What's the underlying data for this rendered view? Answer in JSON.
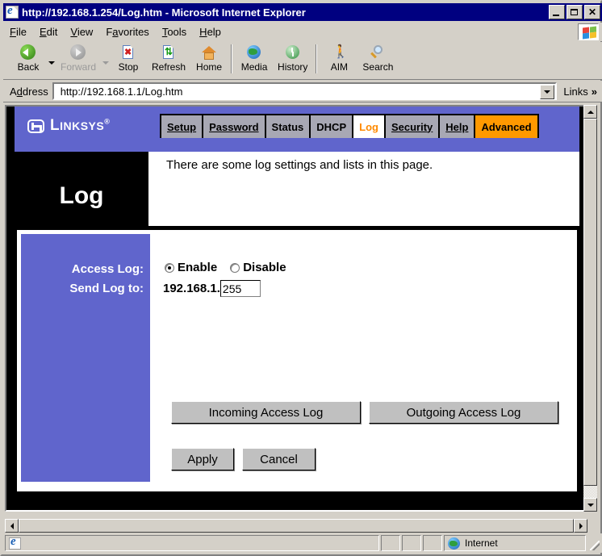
{
  "window": {
    "title": "http://192.168.1.254/Log.htm - Microsoft Internet Explorer",
    "icon": "ie-document-icon",
    "minimize_label": "Minimize",
    "maximize_label": "Maximize",
    "close_label": "Close"
  },
  "menu": {
    "items": [
      {
        "label": "File",
        "accel": "F"
      },
      {
        "label": "Edit",
        "accel": "E"
      },
      {
        "label": "View",
        "accel": "V"
      },
      {
        "label": "Favorites",
        "accel": "a"
      },
      {
        "label": "Tools",
        "accel": "T"
      },
      {
        "label": "Help",
        "accel": "H"
      }
    ],
    "brand_logo": "windows-flag-icon"
  },
  "toolbar": {
    "buttons": [
      {
        "label": "Back",
        "icon": "back-arrow-icon",
        "disabled": false,
        "has_dropdown": true
      },
      {
        "label": "Forward",
        "icon": "forward-arrow-icon",
        "disabled": true,
        "has_dropdown": true
      },
      {
        "label": "Stop",
        "icon": "stop-icon",
        "disabled": false
      },
      {
        "label": "Refresh",
        "icon": "refresh-icon",
        "disabled": false
      },
      {
        "label": "Home",
        "icon": "home-icon",
        "disabled": false
      },
      {
        "label": "Media",
        "icon": "media-globe-icon",
        "disabled": false
      },
      {
        "label": "History",
        "icon": "history-icon",
        "disabled": false
      },
      {
        "label": "AIM",
        "icon": "aim-runner-icon",
        "disabled": false
      },
      {
        "label": "Search",
        "icon": "search-magnifier-icon",
        "disabled": false
      }
    ]
  },
  "address": {
    "label": "Address",
    "label_accel": "d",
    "value": "http://192.168.1.1/Log.htm",
    "placeholder": "",
    "dropdown_icon": "chevron-down-icon",
    "links_label": "Links",
    "links_chevron": "»"
  },
  "page": {
    "brand": {
      "name": "LINKSYS",
      "name_lead": "L",
      "registered": "®",
      "logo_icon": "linksys-logo-icon"
    },
    "tabs": [
      {
        "label": "Setup",
        "state": "link",
        "underline": true
      },
      {
        "label": "Password",
        "state": "link",
        "underline": true
      },
      {
        "label": "Status",
        "state": "link",
        "underline": false
      },
      {
        "label": "DHCP",
        "state": "link",
        "underline": false
      },
      {
        "label": "Log",
        "state": "active",
        "underline": false
      },
      {
        "label": "Security",
        "state": "link",
        "underline": true
      },
      {
        "label": "Help",
        "state": "link",
        "underline": true
      },
      {
        "label": "Advanced",
        "state": "highlight",
        "underline": false
      }
    ],
    "heading": "Log",
    "description": "There are some log settings and lists in this page.",
    "form": {
      "access_log": {
        "label": "Access Log:",
        "options": [
          {
            "label": "Enable",
            "selected": true
          },
          {
            "label": "Disable",
            "selected": false
          }
        ]
      },
      "send_log_to": {
        "label": "Send Log to:",
        "prefix": "192.168.1.",
        "octet_value": "255",
        "octet_placeholder": ""
      },
      "buttons": [
        {
          "label": "Incoming Access Log"
        },
        {
          "label": "Outgoing Access Log"
        },
        {
          "label": "Apply"
        },
        {
          "label": "Cancel"
        }
      ]
    }
  },
  "statusbar": {
    "message": "",
    "zone_label": "Internet",
    "zone_icon": "internet-globe-icon",
    "doc_icon": "ie-document-icon"
  },
  "colors": {
    "titlebar": "#000080",
    "chrome": "#d4d0c8",
    "linksys_purple": "#6065cc",
    "tab_gray": "#a8a8b4",
    "accent_orange": "#ff9900",
    "active_tab_text": "#ff8a00"
  }
}
